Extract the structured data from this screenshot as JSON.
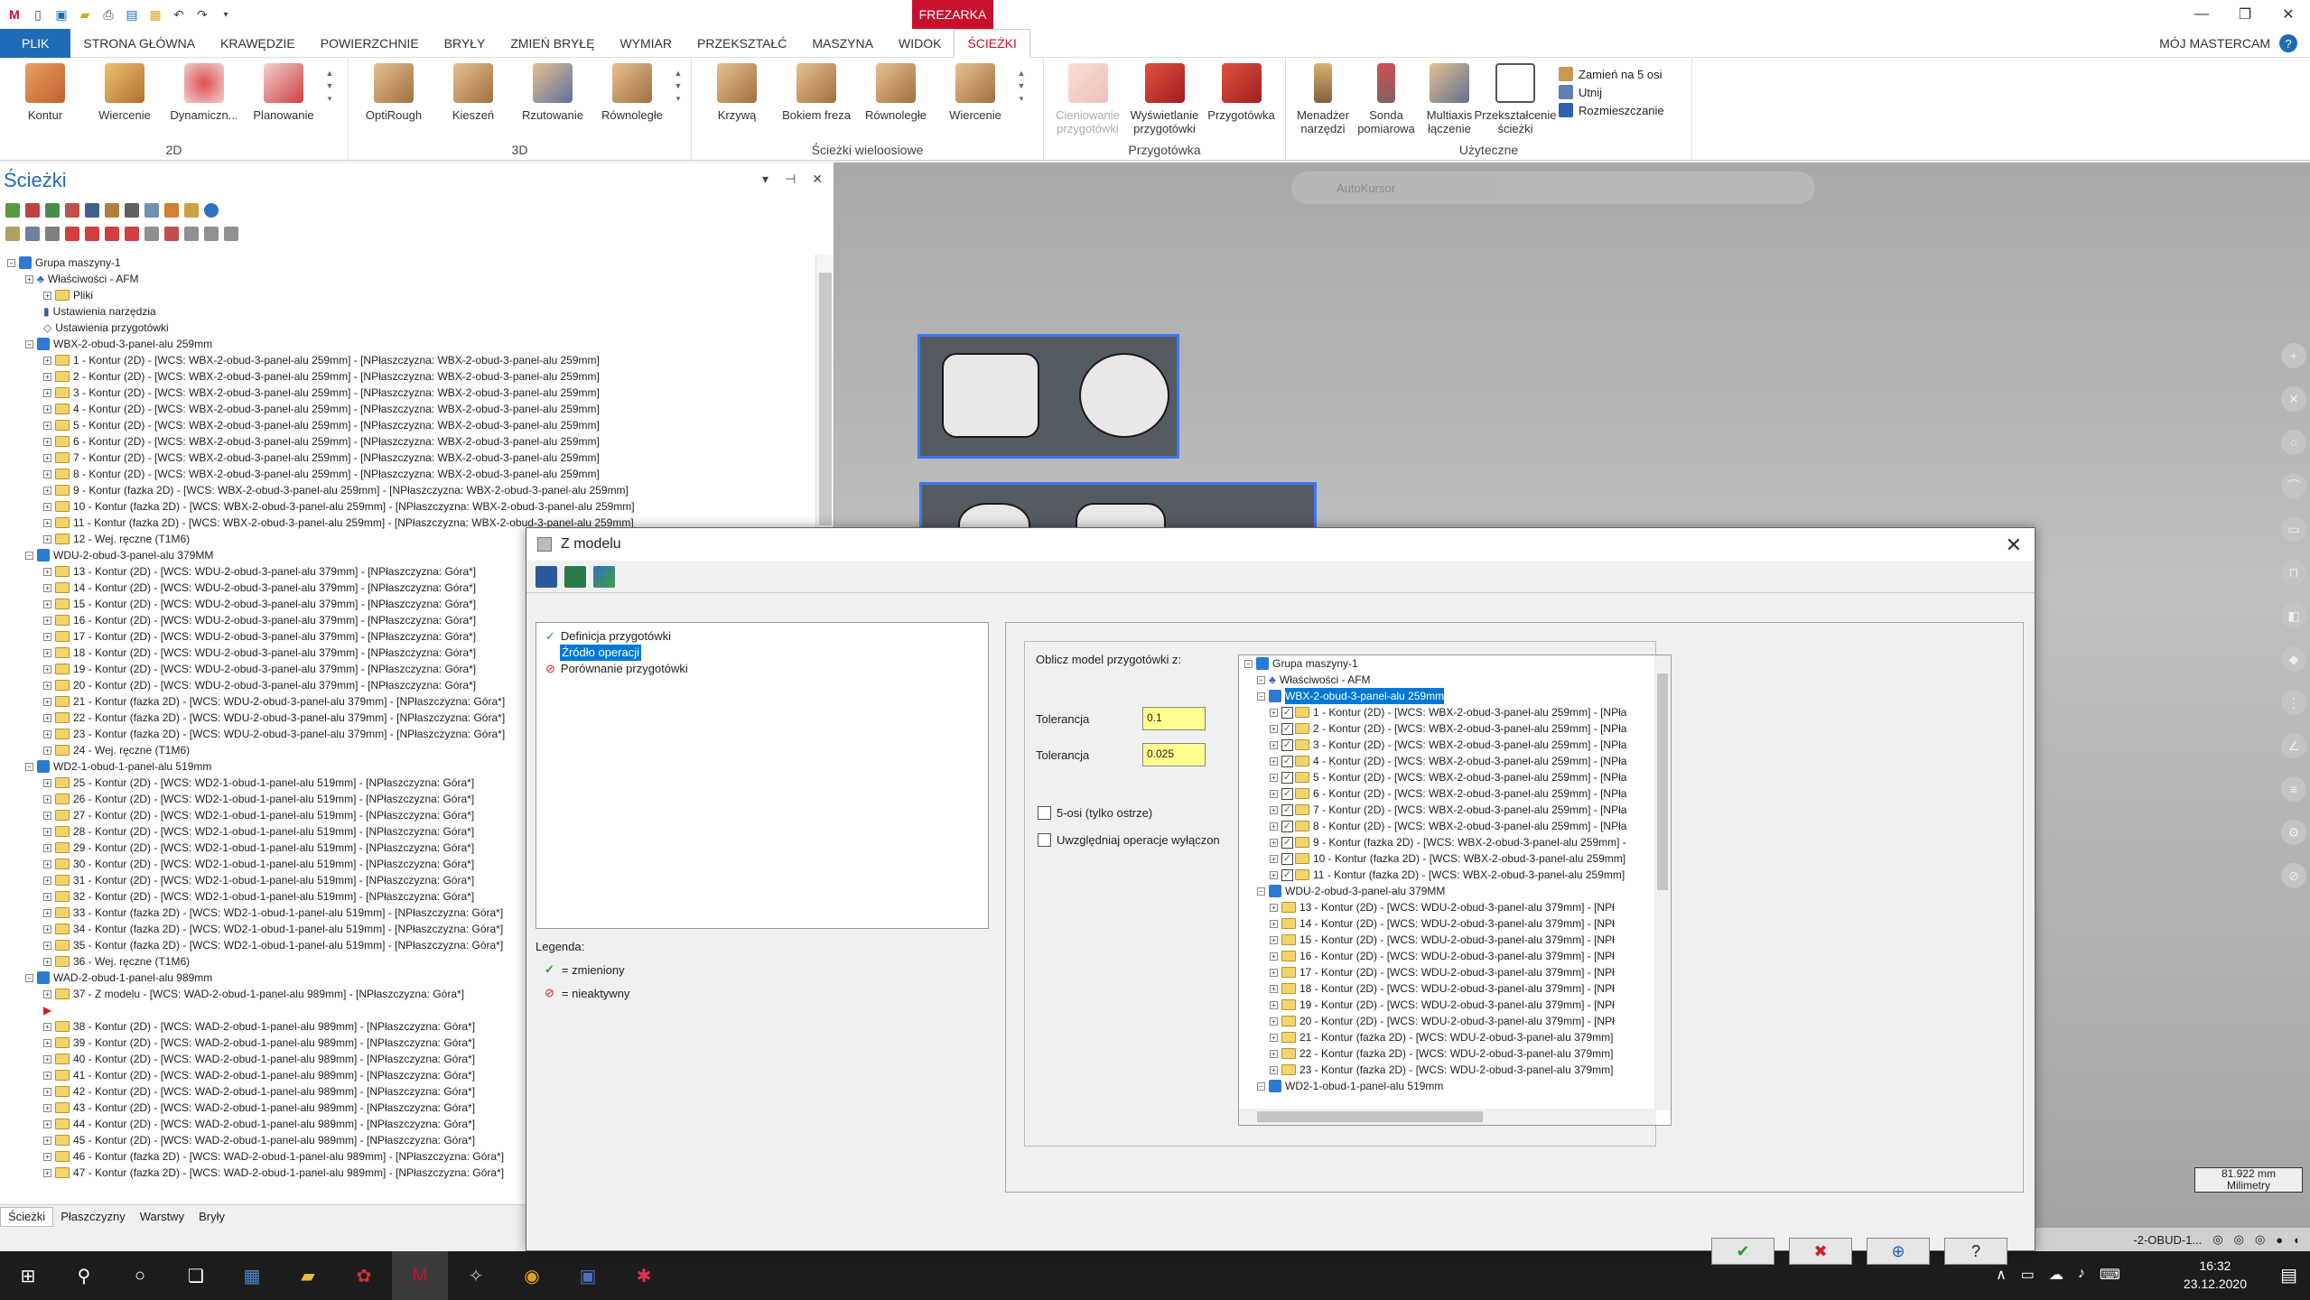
{
  "app": {
    "mode_tab": "FREZARKA",
    "user_label": "MÓJ MASTERCAM"
  },
  "tabs": [
    "PLIK",
    "STRONA GŁÓWNA",
    "KRAWĘDZIE",
    "POWIERZCHNIE",
    "BRYŁY",
    "ZMIEŃ BRYŁĘ",
    "WYMIAR",
    "PRZEKSZTAŁĆ",
    "MASZYNA",
    "WIDOK",
    "ŚCIEŻKI"
  ],
  "ribbon": {
    "g2d": {
      "name": "2D",
      "buttons": [
        "Kontur",
        "Wiercenie",
        "Dynamiczn...",
        "Planowanie"
      ]
    },
    "g3d": {
      "name": "3D",
      "buttons": [
        "OptiRough",
        "Kieszeń",
        "Rzutowanie",
        "Równoległe"
      ]
    },
    "gmulti": {
      "name": "Ścieżki wieloosiowe",
      "buttons": [
        "Krzywą",
        "Bokiem freza",
        "Równoległe",
        "Wiercenie"
      ]
    },
    "gstock": {
      "name": "Przygotówka",
      "buttons": [
        "Cieniowanie przygotówki",
        "Wyświetlanie przygotówki",
        "Przygotówka"
      ]
    },
    "gutil": {
      "name": "Użyteczne",
      "buttons": [
        "Menadżer narzędzi",
        "Sonda pomiarowa",
        "Multiaxis łączenie",
        "Przekształcenie ścieżki"
      ],
      "small": [
        "Zamień na 5 osi",
        "Utnij",
        "Rozmieszczanie"
      ]
    }
  },
  "panel": {
    "title": "Ścieżki",
    "bottom_tabs": [
      "Ścieżki",
      "Płaszczyzny",
      "Warstwy",
      "Bryły"
    ]
  },
  "tree": [
    {
      "lvl": 0,
      "t": "Grupa maszyny-1",
      "k": "grp"
    },
    {
      "lvl": 1,
      "t": "Właściwości - AFM",
      "k": "prop"
    },
    {
      "lvl": 2,
      "t": "Pliki",
      "k": "fld"
    },
    {
      "lvl": 2,
      "t": "Ustawienia narzędzia",
      "k": "tool"
    },
    {
      "lvl": 2,
      "t": "Ustawienia przygotówki",
      "k": "stock"
    },
    {
      "lvl": 1,
      "t": "WBX-2-obud-3-panel-alu 259mm",
      "k": "grp"
    },
    {
      "lvl": 2,
      "t": "1 - Kontur (2D) - [WCS: WBX-2-obud-3-panel-alu 259mm] - [NPłaszczyzna: WBX-2-obud-3-panel-alu 259mm]",
      "k": "fld"
    },
    {
      "lvl": 2,
      "t": "2 - Kontur (2D) - [WCS: WBX-2-obud-3-panel-alu 259mm] - [NPłaszczyzna: WBX-2-obud-3-panel-alu 259mm]",
      "k": "fld"
    },
    {
      "lvl": 2,
      "t": "3 - Kontur (2D) - [WCS: WBX-2-obud-3-panel-alu 259mm] - [NPłaszczyzna: WBX-2-obud-3-panel-alu 259mm]",
      "k": "fld"
    },
    {
      "lvl": 2,
      "t": "4 - Kontur (2D) - [WCS: WBX-2-obud-3-panel-alu 259mm] - [NPłaszczyzna: WBX-2-obud-3-panel-alu 259mm]",
      "k": "fld"
    },
    {
      "lvl": 2,
      "t": "5 - Kontur (2D) - [WCS: WBX-2-obud-3-panel-alu 259mm] - [NPłaszczyzna: WBX-2-obud-3-panel-alu 259mm]",
      "k": "fld"
    },
    {
      "lvl": 2,
      "t": "6 - Kontur (2D) - [WCS: WBX-2-obud-3-panel-alu 259mm] - [NPłaszczyzna: WBX-2-obud-3-panel-alu 259mm]",
      "k": "fld"
    },
    {
      "lvl": 2,
      "t": "7 - Kontur (2D) - [WCS: WBX-2-obud-3-panel-alu 259mm] - [NPłaszczyzna: WBX-2-obud-3-panel-alu 259mm]",
      "k": "fld"
    },
    {
      "lvl": 2,
      "t": "8 - Kontur (2D) - [WCS: WBX-2-obud-3-panel-alu 259mm] - [NPłaszczyzna: WBX-2-obud-3-panel-alu 259mm]",
      "k": "fld"
    },
    {
      "lvl": 2,
      "t": "9 - Kontur (fazka 2D) - [WCS: WBX-2-obud-3-panel-alu 259mm] - [NPłaszczyzna: WBX-2-obud-3-panel-alu 259mm]",
      "k": "fld"
    },
    {
      "lvl": 2,
      "t": "10 - Kontur (fazka 2D) - [WCS: WBX-2-obud-3-panel-alu 259mm] - [NPłaszczyzna: WBX-2-obud-3-panel-alu 259mm]",
      "k": "fld"
    },
    {
      "lvl": 2,
      "t": "11 - Kontur (fazka 2D) - [WCS: WBX-2-obud-3-panel-alu 259mm] - [NPłaszczyzna: WBX-2-obud-3-panel-alu 259mm]",
      "k": "fld"
    },
    {
      "lvl": 2,
      "t": "12 - Wej. ręczne (T1M6)",
      "k": "fld"
    },
    {
      "lvl": 1,
      "t": "WDU-2-obud-3-panel-alu 379MM",
      "k": "grp"
    },
    {
      "lvl": 2,
      "t": "13 - Kontur (2D) - [WCS: WDU-2-obud-3-panel-alu 379mm] - [NPłaszczyzna: Góra*]",
      "k": "fld"
    },
    {
      "lvl": 2,
      "t": "14 - Kontur (2D) - [WCS: WDU-2-obud-3-panel-alu 379mm] - [NPłaszczyzna: Góra*]",
      "k": "fld"
    },
    {
      "lvl": 2,
      "t": "15 - Kontur (2D) - [WCS: WDU-2-obud-3-panel-alu 379mm] - [NPłaszczyzna: Góra*]",
      "k": "fld"
    },
    {
      "lvl": 2,
      "t": "16 - Kontur (2D) - [WCS: WDU-2-obud-3-panel-alu 379mm] - [NPłaszczyzna: Góra*]",
      "k": "fld"
    },
    {
      "lvl": 2,
      "t": "17 - Kontur (2D) - [WCS: WDU-2-obud-3-panel-alu 379mm] - [NPłaszczyzna: Góra*]",
      "k": "fld"
    },
    {
      "lvl": 2,
      "t": "18 - Kontur (2D) - [WCS: WDU-2-obud-3-panel-alu 379mm] - [NPłaszczyzna: Góra*]",
      "k": "fld"
    },
    {
      "lvl": 2,
      "t": "19 - Kontur (2D) - [WCS: WDU-2-obud-3-panel-alu 379mm] - [NPłaszczyzna: Góra*]",
      "k": "fld"
    },
    {
      "lvl": 2,
      "t": "20 - Kontur (2D) - [WCS: WDU-2-obud-3-panel-alu 379mm] - [NPłaszczyzna: Góra*]",
      "k": "fld"
    },
    {
      "lvl": 2,
      "t": "21 - Kontur (fazka 2D) - [WCS: WDU-2-obud-3-panel-alu 379mm] - [NPłaszczyzna: Góra*]",
      "k": "fld"
    },
    {
      "lvl": 2,
      "t": "22 - Kontur (fazka 2D) - [WCS: WDU-2-obud-3-panel-alu 379mm] - [NPłaszczyzna: Góra*]",
      "k": "fld"
    },
    {
      "lvl": 2,
      "t": "23 - Kontur (fazka 2D) - [WCS: WDU-2-obud-3-panel-alu 379mm] - [NPłaszczyzna: Góra*]",
      "k": "fld"
    },
    {
      "lvl": 2,
      "t": "24 - Wej. ręczne (T1M6)",
      "k": "fld"
    },
    {
      "lvl": 1,
      "t": "WD2-1-obud-1-panel-alu 519mm",
      "k": "grp"
    },
    {
      "lvl": 2,
      "t": "25 - Kontur (2D) - [WCS: WD2-1-obud-1-panel-alu 519mm] - [NPłaszczyzna: Góra*]",
      "k": "fld"
    },
    {
      "lvl": 2,
      "t": "26 - Kontur (2D) - [WCS: WD2-1-obud-1-panel-alu 519mm] - [NPłaszczyzna: Góra*]",
      "k": "fld"
    },
    {
      "lvl": 2,
      "t": "27 - Kontur (2D) - [WCS: WD2-1-obud-1-panel-alu 519mm] - [NPłaszczyzna: Góra*]",
      "k": "fld"
    },
    {
      "lvl": 2,
      "t": "28 - Kontur (2D) - [WCS: WD2-1-obud-1-panel-alu 519mm] - [NPłaszczyzna: Góra*]",
      "k": "fld"
    },
    {
      "lvl": 2,
      "t": "29 - Kontur (2D) - [WCS: WD2-1-obud-1-panel-alu 519mm] - [NPłaszczyzna: Góra*]",
      "k": "fld"
    },
    {
      "lvl": 2,
      "t": "30 - Kontur (2D) - [WCS: WD2-1-obud-1-panel-alu 519mm] - [NPłaszczyzna: Góra*]",
      "k": "fld"
    },
    {
      "lvl": 2,
      "t": "31 - Kontur (2D) - [WCS: WD2-1-obud-1-panel-alu 519mm] - [NPłaszczyzna: Góra*]",
      "k": "fld"
    },
    {
      "lvl": 2,
      "t": "32 - Kontur (2D) - [WCS: WD2-1-obud-1-panel-alu 519mm] - [NPłaszczyzna: Góra*]",
      "k": "fld"
    },
    {
      "lvl": 2,
      "t": "33 - Kontur (fazka 2D) - [WCS: WD2-1-obud-1-panel-alu 519mm] - [NPłaszczyzna: Góra*]",
      "k": "fld"
    },
    {
      "lvl": 2,
      "t": "34 - Kontur (fazka 2D) - [WCS: WD2-1-obud-1-panel-alu 519mm] - [NPłaszczyzna: Góra*]",
      "k": "fld"
    },
    {
      "lvl": 2,
      "t": "35 - Kontur (fazka 2D) - [WCS: WD2-1-obud-1-panel-alu 519mm] - [NPłaszczyzna: Góra*]",
      "k": "fld"
    },
    {
      "lvl": 2,
      "t": "36 - Wej. ręczne (T1M6)",
      "k": "fld"
    },
    {
      "lvl": 1,
      "t": "WAD-2-obud-1-panel-alu 989mm",
      "k": "grp"
    },
    {
      "lvl": 2,
      "t": "37 - Z modelu - [WCS: WAD-2-obud-1-panel-alu 989mm] - [NPłaszczyzna: Góra*]",
      "k": "fld"
    },
    {
      "lvl": 2,
      "t": "",
      "k": "mark"
    },
    {
      "lvl": 2,
      "t": "38 - Kontur (2D) - [WCS: WAD-2-obud-1-panel-alu 989mm] - [NPłaszczyzna: Góra*]",
      "k": "fld"
    },
    {
      "lvl": 2,
      "t": "39 - Kontur (2D) - [WCS: WAD-2-obud-1-panel-alu 989mm] - [NPłaszczyzna: Góra*]",
      "k": "fld"
    },
    {
      "lvl": 2,
      "t": "40 - Kontur (2D) - [WCS: WAD-2-obud-1-panel-alu 989mm] - [NPłaszczyzna: Góra*]",
      "k": "fld"
    },
    {
      "lvl": 2,
      "t": "41 - Kontur (2D) - [WCS: WAD-2-obud-1-panel-alu 989mm] - [NPłaszczyzna: Góra*]",
      "k": "fld"
    },
    {
      "lvl": 2,
      "t": "42 - Kontur (2D) - [WCS: WAD-2-obud-1-panel-alu 989mm] - [NPłaszczyzna: Góra*]",
      "k": "fld"
    },
    {
      "lvl": 2,
      "t": "43 - Kontur (2D) - [WCS: WAD-2-obud-1-panel-alu 989mm] - [NPłaszczyzna: Góra*]",
      "k": "fld"
    },
    {
      "lvl": 2,
      "t": "44 - Kontur (2D) - [WCS: WAD-2-obud-1-panel-alu 989mm] - [NPłaszczyzna: Góra*]",
      "k": "fld"
    },
    {
      "lvl": 2,
      "t": "45 - Kontur (2D) - [WCS: WAD-2-obud-1-panel-alu 989mm] - [NPłaszczyzna: Góra*]",
      "k": "fld"
    },
    {
      "lvl": 2,
      "t": "46 - Kontur (fazka 2D) - [WCS: WAD-2-obud-1-panel-alu 989mm] - [NPłaszczyzna: Góra*]",
      "k": "fld"
    },
    {
      "lvl": 2,
      "t": "47 - Kontur (fazka 2D) - [WCS: WAD-2-obud-1-panel-alu 989mm] - [NPłaszczyzna: Góra*]",
      "k": "fld"
    }
  ],
  "viewport": {
    "autokursor": "AutoKursor",
    "scale_value": "81.922 mm",
    "scale_unit": "Milimetry",
    "status_text": "-2-OBUD-1..."
  },
  "dialog": {
    "title": "Z modelu",
    "nav": [
      {
        "t": "Definicja przygotówki",
        "s": "ok"
      },
      {
        "t": "Źródło operacji",
        "s": "sel"
      },
      {
        "t": "Porównanie przygotówki",
        "s": "bad"
      }
    ],
    "legend_title": "Legenda:",
    "legend": [
      {
        "sym": "✓",
        "t": "= zmieniony"
      },
      {
        "sym": "⊘",
        "t": "= nieaktywny"
      }
    ],
    "calc_label": "Oblicz model przygotówki z:",
    "tol_label": "Tolerancja",
    "tol1": "0.1",
    "tol2": "0.025",
    "chk1": "5-osi (tylko ostrze)",
    "chk2": "Uwzględniaj operacje wyłączon",
    "ops": [
      {
        "lvl": 0,
        "t": "Grupa maszyny-1",
        "k": "grp"
      },
      {
        "lvl": 1,
        "t": "Właściwości - AFM",
        "k": "prop"
      },
      {
        "lvl": 1,
        "t": "WBX-2-obud-3-panel-alu 259mm",
        "k": "grpsel"
      },
      {
        "lvl": 2,
        "t": "1 - Kontur (2D) - [WCS: WBX-2-obud-3-panel-alu 259mm] - [NPła",
        "k": "chk"
      },
      {
        "lvl": 2,
        "t": "2 - Kontur (2D) - [WCS: WBX-2-obud-3-panel-alu 259mm] - [NPła",
        "k": "chk"
      },
      {
        "lvl": 2,
        "t": "3 - Kontur (2D) - [WCS: WBX-2-obud-3-panel-alu 259mm] - [NPła",
        "k": "chk"
      },
      {
        "lvl": 2,
        "t": "4 - Kontur (2D) - [WCS: WBX-2-obud-3-panel-alu 259mm] - [NPła",
        "k": "chk"
      },
      {
        "lvl": 2,
        "t": "5 - Kontur (2D) - [WCS: WBX-2-obud-3-panel-alu 259mm] - [NPła",
        "k": "chk"
      },
      {
        "lvl": 2,
        "t": "6 - Kontur (2D) - [WCS: WBX-2-obud-3-panel-alu 259mm] - [NPła",
        "k": "chk"
      },
      {
        "lvl": 2,
        "t": "7 - Kontur (2D) - [WCS: WBX-2-obud-3-panel-alu 259mm] - [NPła",
        "k": "chk"
      },
      {
        "lvl": 2,
        "t": "8 - Kontur (2D) - [WCS: WBX-2-obud-3-panel-alu 259mm] - [NPła",
        "k": "chk"
      },
      {
        "lvl": 2,
        "t": "9 - Kontur (fazka 2D) - [WCS: WBX-2-obud-3-panel-alu 259mm] -",
        "k": "chk"
      },
      {
        "lvl": 2,
        "t": "10 - Kontur (fazka 2D) - [WCS: WBX-2-obud-3-panel-alu 259mm]",
        "k": "chk"
      },
      {
        "lvl": 2,
        "t": "11 - Kontur (fazka 2D) - [WCS: WBX-2-obud-3-panel-alu 259mm]",
        "k": "chk"
      },
      {
        "lvl": 1,
        "t": "WDU-2-obud-3-panel-alu 379MM",
        "k": "grp"
      },
      {
        "lvl": 2,
        "t": "13 - Kontur (2D) - [WCS: WDU-2-obud-3-panel-alu 379mm] - [NPł",
        "k": "fld"
      },
      {
        "lvl": 2,
        "t": "14 - Kontur (2D) - [WCS: WDU-2-obud-3-panel-alu 379mm] - [NPł",
        "k": "fld"
      },
      {
        "lvl": 2,
        "t": "15 - Kontur (2D) - [WCS: WDU-2-obud-3-panel-alu 379mm] - [NPł",
        "k": "fld"
      },
      {
        "lvl": 2,
        "t": "16 - Kontur (2D) - [WCS: WDU-2-obud-3-panel-alu 379mm] - [NPł",
        "k": "fld"
      },
      {
        "lvl": 2,
        "t": "17 - Kontur (2D) - [WCS: WDU-2-obud-3-panel-alu 379mm] - [NPł",
        "k": "fld"
      },
      {
        "lvl": 2,
        "t": "18 - Kontur (2D) - [WCS: WDU-2-obud-3-panel-alu 379mm] - [NPł",
        "k": "fld"
      },
      {
        "lvl": 2,
        "t": "19 - Kontur (2D) - [WCS: WDU-2-obud-3-panel-alu 379mm] - [NPł",
        "k": "fld"
      },
      {
        "lvl": 2,
        "t": "20 - Kontur (2D) - [WCS: WDU-2-obud-3-panel-alu 379mm] - [NPł",
        "k": "fld"
      },
      {
        "lvl": 2,
        "t": "21 - Kontur (fazka 2D) - [WCS: WDU-2-obud-3-panel-alu 379mm]",
        "k": "fld"
      },
      {
        "lvl": 2,
        "t": "22 - Kontur (fazka 2D) - [WCS: WDU-2-obud-3-panel-alu 379mm]",
        "k": "fld"
      },
      {
        "lvl": 2,
        "t": "23 - Kontur (fazka 2D) - [WCS: WDU-2-obud-3-panel-alu 379mm]",
        "k": "fld"
      },
      {
        "lvl": 1,
        "t": "WD2-1-obud-1-panel-alu 519mm",
        "k": "grp"
      }
    ]
  },
  "taskbar": {
    "time": "16:32",
    "date": "23.12.2020"
  }
}
